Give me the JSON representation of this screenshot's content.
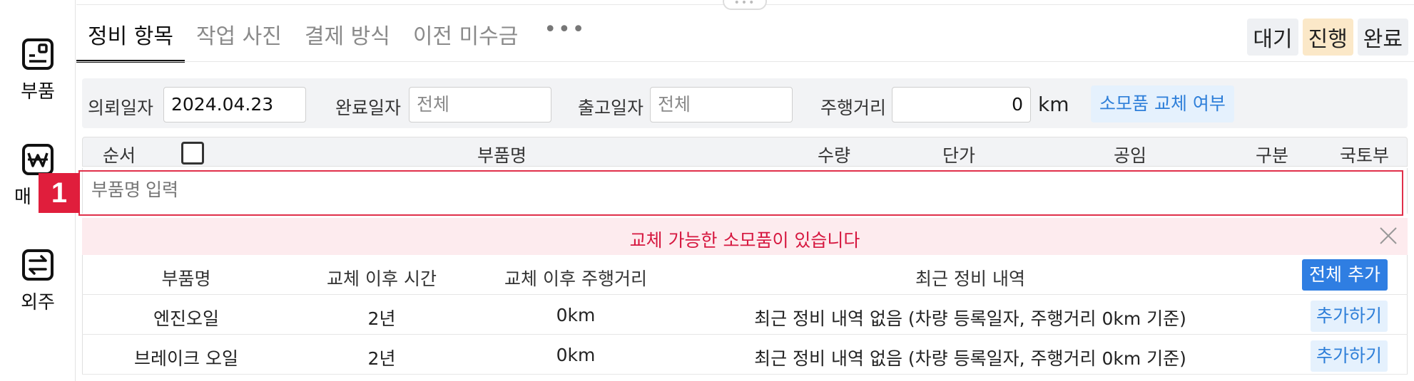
{
  "sidebar": {
    "items": [
      {
        "label": "부품",
        "icon": "parts-icon"
      },
      {
        "label": "매",
        "icon": "won-icon"
      },
      {
        "label": "외주",
        "icon": "outsource-icon"
      }
    ]
  },
  "tabs": {
    "items": [
      "정비 항목",
      "작업 사진",
      "결제 방식",
      "이전 미수금"
    ],
    "more": "•••"
  },
  "status": {
    "wait": "대기",
    "progress": "진행",
    "done": "완료"
  },
  "filters": {
    "request_date_label": "의뢰일자",
    "request_date_value": "2024.04.23",
    "complete_date_label": "완료일자",
    "complete_date_placeholder": "전체",
    "release_date_label": "출고일자",
    "release_date_placeholder": "전체",
    "mileage_label": "주행거리",
    "mileage_value": "0",
    "mileage_unit": "km",
    "consumable_toggle": "소모품 교체 여부"
  },
  "parts_table": {
    "headers": {
      "order": "순서",
      "name": "부품명",
      "qty": "수량",
      "unit_price": "단가",
      "labor": "공임",
      "category": "구분",
      "ministry": "국토부"
    },
    "input_placeholder": "부품명 입력"
  },
  "marker_label": "1",
  "consumables": {
    "alert": "교체 가능한 소모품이 있습니다",
    "headers": {
      "name": "부품명",
      "time_since": "교체 이후 시간",
      "distance_since": "교체 이후 주행거리",
      "recent": "최근 정비 내역",
      "add_all": "전체 추가"
    },
    "rows": [
      {
        "name": "엔진오일",
        "time": "2년",
        "distance": "0km",
        "recent": "최근 정비 내역 없음 (차량 등록일자, 주행거리 0km 기준)",
        "action": "추가하기"
      },
      {
        "name": "브레이크 오일",
        "time": "2년",
        "distance": "0km",
        "recent": "최근 정비 내역 없음 (차량 등록일자, 주행거리 0km 기준)",
        "action": "추가하기"
      }
    ]
  },
  "colors": {
    "accent_blue": "#2f7ee2",
    "alert_red": "#d6173f",
    "highlight_red": "#e0304a",
    "progress_bg": "#fbe8c8"
  }
}
